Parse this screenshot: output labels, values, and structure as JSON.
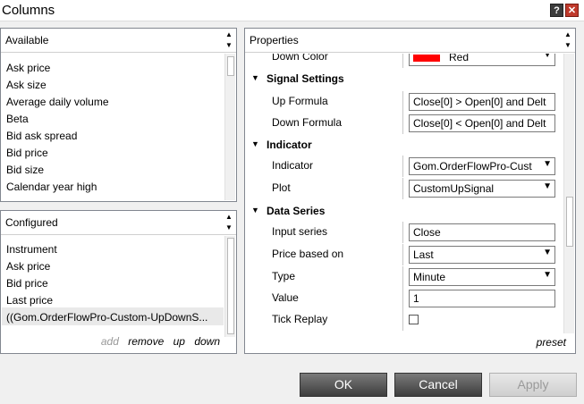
{
  "window": {
    "title": "Columns",
    "help_glyph": "?",
    "close_glyph": "✕"
  },
  "available": {
    "header": "Available",
    "items": [
      "Ask price",
      "Ask size",
      "Average daily volume",
      "Beta",
      "Bid ask spread",
      "Bid price",
      "Bid size",
      "Calendar year high"
    ]
  },
  "configured": {
    "header": "Configured",
    "items": [
      "Instrument",
      "Ask price",
      "Bid price",
      "Last price",
      "((Gom.OrderFlowPro-Custom-UpDownS..."
    ],
    "selected_index": 4,
    "actions": {
      "add": "add",
      "remove": "remove",
      "up": "up",
      "down": "down"
    }
  },
  "properties": {
    "header": "Properties",
    "down_color": {
      "label": "Down Color",
      "value": "Red",
      "swatch": "#ff0000"
    },
    "signal_settings": {
      "title": "Signal Settings",
      "up_formula": {
        "label": "Up Formula",
        "value": "Close[0] > Open[0] and Delt"
      },
      "down_formula": {
        "label": "Down Formula",
        "value": "Close[0] < Open[0] and Delt"
      }
    },
    "indicator_cat": {
      "title": "Indicator",
      "indicator": {
        "label": "Indicator",
        "value": "Gom.OrderFlowPro-Cust"
      },
      "plot": {
        "label": "Plot",
        "value": "CustomUpSignal"
      }
    },
    "data_series": {
      "title": "Data Series",
      "input_series": {
        "label": "Input series",
        "value": "Close"
      },
      "price_based_on": {
        "label": "Price based on",
        "value": "Last"
      },
      "type": {
        "label": "Type",
        "value": "Minute"
      },
      "value": {
        "label": "Value",
        "value": "1"
      },
      "tick_replay": {
        "label": "Tick Replay",
        "checked": false
      }
    },
    "preset": "preset"
  },
  "buttons": {
    "ok": "OK",
    "cancel": "Cancel",
    "apply": "Apply"
  }
}
